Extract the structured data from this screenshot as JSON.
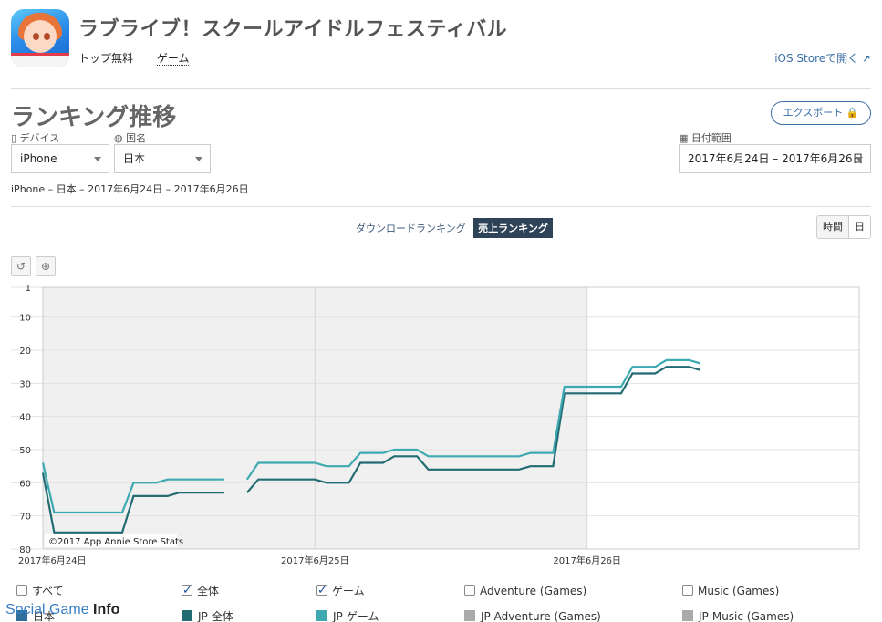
{
  "app": {
    "title": "ラブライブ！スクールアイドルフェスティバル",
    "category": "トップ無料",
    "genre": "ゲーム",
    "store_link": "iOS Storeで開く ↗"
  },
  "page": {
    "title": "ランキング推移",
    "export_label": "エクスポート 🔒"
  },
  "filters": {
    "device_label": "▯ デバイス",
    "device_value": "iPhone",
    "country_label": "◍ 国名",
    "country_value": "日本",
    "date_label": "▦ 日付範囲",
    "date_value": "2017年6月24日 – 2017年6月26日",
    "summary": "iPhone – 日本 – 2017年6月24日 – 2017年6月26日"
  },
  "tabs": {
    "download": "ダウンロードランキング",
    "revenue": "売上ランキング",
    "granularity_hour": "時間",
    "granularity_day": "日"
  },
  "chart_controls": {
    "reset_icon": "undo-icon",
    "zoom_icon": "zoom-icon"
  },
  "chart_data": {
    "type": "line",
    "y_reversed": true,
    "ylim": [
      1,
      80
    ],
    "yticks": [
      1,
      10,
      20,
      30,
      40,
      50,
      60,
      70,
      80
    ],
    "x_range": [
      0,
      72
    ],
    "x_unit": "hours since 2017年6月24日 00:00",
    "xticks": [
      {
        "x": 0,
        "label": "2017年6月24日"
      },
      {
        "x": 24,
        "label": "2017年6月25日"
      },
      {
        "x": 48,
        "label": "2017年6月26日"
      }
    ],
    "shaded_range": [
      0,
      48
    ],
    "credit": "©2017 App Annie Store Stats",
    "series": [
      {
        "name": "JP-全体",
        "color": "#236b72",
        "segments": [
          [
            [
              0,
              57
            ],
            [
              1,
              75
            ],
            [
              2,
              75
            ],
            [
              3,
              75
            ],
            [
              4,
              75
            ],
            [
              5,
              75
            ],
            [
              6,
              75
            ],
            [
              7,
              75
            ],
            [
              8,
              64
            ],
            [
              9,
              64
            ],
            [
              10,
              64
            ],
            [
              11,
              64
            ],
            [
              12,
              63
            ],
            [
              13,
              63
            ],
            [
              14,
              63
            ],
            [
              15,
              63
            ],
            [
              16,
              63
            ]
          ],
          [
            [
              18,
              63
            ],
            [
              19,
              59
            ],
            [
              20,
              59
            ],
            [
              21,
              59
            ],
            [
              22,
              59
            ],
            [
              23,
              59
            ],
            [
              24,
              59
            ],
            [
              25,
              60
            ],
            [
              26,
              60
            ],
            [
              27,
              60
            ],
            [
              28,
              54
            ],
            [
              29,
              54
            ],
            [
              30,
              54
            ],
            [
              31,
              52
            ],
            [
              32,
              52
            ],
            [
              33,
              52
            ],
            [
              34,
              56
            ],
            [
              35,
              56
            ],
            [
              36,
              56
            ],
            [
              37,
              56
            ],
            [
              38,
              56
            ],
            [
              39,
              56
            ],
            [
              40,
              56
            ],
            [
              41,
              56
            ],
            [
              42,
              56
            ],
            [
              43,
              55
            ],
            [
              44,
              55
            ],
            [
              45,
              55
            ],
            [
              46,
              33
            ],
            [
              47,
              33
            ],
            [
              48,
              33
            ],
            [
              49,
              33
            ],
            [
              50,
              33
            ],
            [
              51,
              33
            ],
            [
              52,
              27
            ],
            [
              53,
              27
            ],
            [
              54,
              27
            ],
            [
              55,
              25
            ],
            [
              56,
              25
            ],
            [
              57,
              25
            ],
            [
              58,
              26
            ]
          ]
        ]
      },
      {
        "name": "JP-ゲーム",
        "color": "#3ea9b0",
        "segments": [
          [
            [
              0,
              54
            ],
            [
              1,
              69
            ],
            [
              2,
              69
            ],
            [
              3,
              69
            ],
            [
              4,
              69
            ],
            [
              5,
              69
            ],
            [
              6,
              69
            ],
            [
              7,
              69
            ],
            [
              8,
              60
            ],
            [
              9,
              60
            ],
            [
              10,
              60
            ],
            [
              11,
              59
            ],
            [
              12,
              59
            ],
            [
              13,
              59
            ],
            [
              14,
              59
            ],
            [
              15,
              59
            ],
            [
              16,
              59
            ]
          ],
          [
            [
              18,
              59
            ],
            [
              19,
              54
            ],
            [
              20,
              54
            ],
            [
              21,
              54
            ],
            [
              22,
              54
            ],
            [
              23,
              54
            ],
            [
              24,
              54
            ],
            [
              25,
              55
            ],
            [
              26,
              55
            ],
            [
              27,
              55
            ],
            [
              28,
              51
            ],
            [
              29,
              51
            ],
            [
              30,
              51
            ],
            [
              31,
              50
            ],
            [
              32,
              50
            ],
            [
              33,
              50
            ],
            [
              34,
              52
            ],
            [
              35,
              52
            ],
            [
              36,
              52
            ],
            [
              37,
              52
            ],
            [
              38,
              52
            ],
            [
              39,
              52
            ],
            [
              40,
              52
            ],
            [
              41,
              52
            ],
            [
              42,
              52
            ],
            [
              43,
              51
            ],
            [
              44,
              51
            ],
            [
              45,
              51
            ],
            [
              46,
              31
            ],
            [
              47,
              31
            ],
            [
              48,
              31
            ],
            [
              49,
              31
            ],
            [
              50,
              31
            ],
            [
              51,
              31
            ],
            [
              52,
              25
            ],
            [
              53,
              25
            ],
            [
              54,
              25
            ],
            [
              55,
              23
            ],
            [
              56,
              23
            ],
            [
              57,
              23
            ],
            [
              58,
              24
            ]
          ]
        ]
      }
    ]
  },
  "legend": {
    "row1": [
      {
        "label": "すべて",
        "checked": false
      },
      {
        "label": "全体",
        "checked": true
      },
      {
        "label": "ゲーム",
        "checked": true
      },
      {
        "label": "Adventure (Games)",
        "checked": false
      },
      {
        "label": "Music (Games)",
        "checked": false
      }
    ],
    "row2": [
      {
        "label": "日本",
        "color": "#2f6f9c"
      },
      {
        "label": "JP-全体",
        "color": "#236b72"
      },
      {
        "label": "JP-ゲーム",
        "color": "#3ea9b0"
      },
      {
        "label": "JP-Adventure (Games)",
        "color": "#aaaaaa"
      },
      {
        "label": "JP-Music (Games)",
        "color": "#aaaaaa"
      }
    ]
  },
  "watermark": {
    "text1": "Social Game ",
    "text2": "Info"
  }
}
